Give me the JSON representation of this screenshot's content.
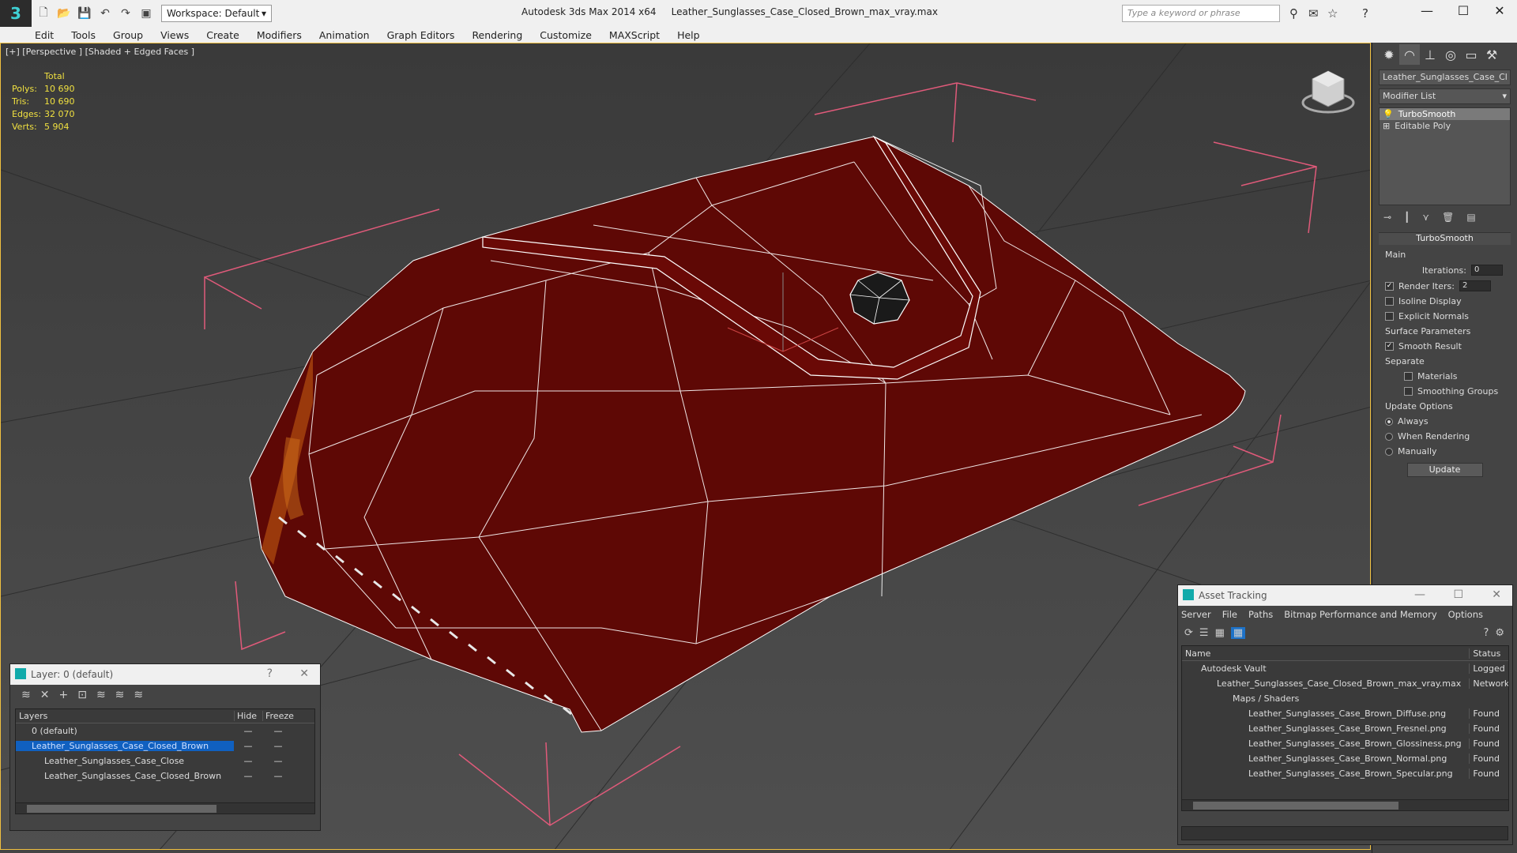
{
  "titlebar": {
    "workspace_label": "Workspace: Default",
    "app_name": "Autodesk 3ds Max  2014 x64",
    "file_name": "Leather_Sunglasses_Case_Closed_Brown_max_vray.max",
    "search_placeholder": "Type a keyword or phrase"
  },
  "menu": [
    "Edit",
    "Tools",
    "Group",
    "Views",
    "Create",
    "Modifiers",
    "Animation",
    "Graph Editors",
    "Rendering",
    "Customize",
    "MAXScript",
    "Help"
  ],
  "viewport": {
    "label": "[+] [Perspective ] [Shaded + Edged Faces ]",
    "stats": {
      "header": "Total",
      "polys_label": "Polys:",
      "polys": "10 690",
      "tris_label": "Tris:",
      "tris": "10 690",
      "edges_label": "Edges:",
      "edges": "32 070",
      "verts_label": "Verts:",
      "verts": "5 904"
    }
  },
  "command_panel": {
    "object_name": "Leather_Sunglasses_Case_Cl",
    "modifier_list": "Modifier List",
    "stack": [
      {
        "label": "TurboSmooth",
        "selected": true
      },
      {
        "label": "Editable Poly",
        "selected": false
      }
    ],
    "rollout_title": "TurboSmooth",
    "main_group": "Main",
    "iterations_label": "Iterations:",
    "iterations_value": "0",
    "render_iters_label": "Render Iters:",
    "render_iters_value": "2",
    "isoline_label": "Isoline Display",
    "explicit_label": "Explicit Normals",
    "surface_group": "Surface Parameters",
    "smooth_result_label": "Smooth Result",
    "separate_label": "Separate",
    "materials_label": "Materials",
    "smoothing_groups_label": "Smoothing Groups",
    "update_group": "Update Options",
    "always_label": "Always",
    "when_rendering_label": "When Rendering",
    "manually_label": "Manually",
    "update_button": "Update"
  },
  "layer_dialog": {
    "title": "Layer: 0 (default)",
    "columns": {
      "layers": "Layers",
      "hide": "Hide",
      "freeze": "Freeze"
    },
    "rows": [
      {
        "name": "0 (default)",
        "indent": 1
      },
      {
        "name": "Leather_Sunglasses_Case_Closed_Brown",
        "indent": 1
      },
      {
        "name": "Leather_Sunglasses_Case_Close",
        "indent": 2
      },
      {
        "name": "Leather_Sunglasses_Case_Closed_Brown",
        "indent": 2
      }
    ]
  },
  "asset_dialog": {
    "title": "Asset Tracking",
    "menu": [
      "Server",
      "File",
      "Paths",
      "Bitmap Performance and Memory",
      "Options"
    ],
    "columns": {
      "name": "Name",
      "status": "Status"
    },
    "rows": [
      {
        "name": "Autodesk Vault",
        "status": "Logged",
        "indent": 1
      },
      {
        "name": "Leather_Sunglasses_Case_Closed_Brown_max_vray.max",
        "status": "Network",
        "indent": 2
      },
      {
        "name": "Maps / Shaders",
        "status": "",
        "indent": 3
      },
      {
        "name": "Leather_Sunglasses_Case_Brown_Diffuse.png",
        "status": "Found",
        "indent": 4
      },
      {
        "name": "Leather_Sunglasses_Case_Brown_Fresnel.png",
        "status": "Found",
        "indent": 4
      },
      {
        "name": "Leather_Sunglasses_Case_Brown_Glossiness.png",
        "status": "Found",
        "indent": 4
      },
      {
        "name": "Leather_Sunglasses_Case_Brown_Normal.png",
        "status": "Found",
        "indent": 4
      },
      {
        "name": "Leather_Sunglasses_Case_Brown_Specular.png",
        "status": "Found",
        "indent": 4
      }
    ]
  },
  "colors": {
    "stats_text": "#f0e040",
    "selection": "#1060c0",
    "case_leather": "#6a0a06",
    "wire": "#ffffff",
    "bbox": "#e05a7a"
  }
}
